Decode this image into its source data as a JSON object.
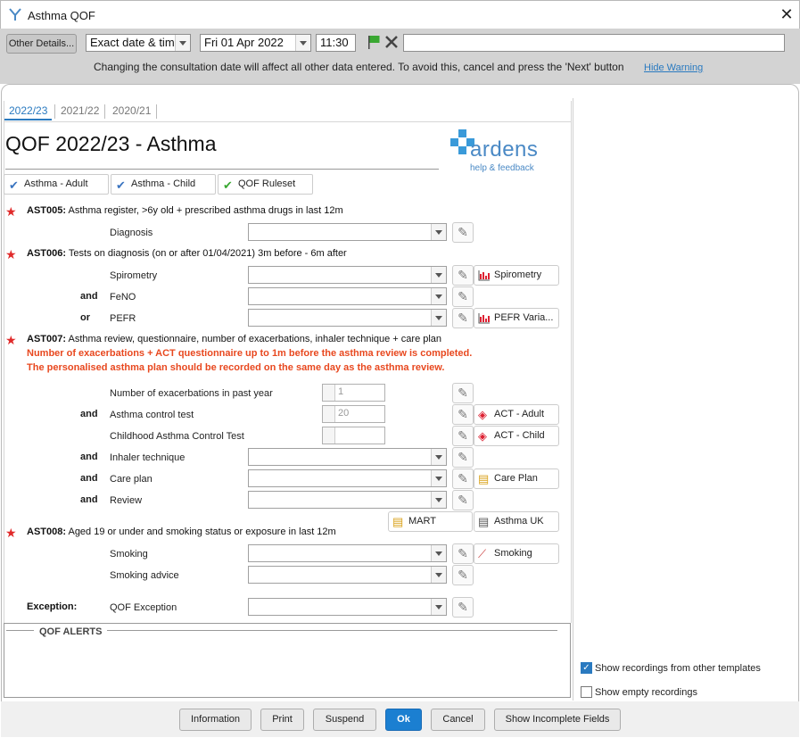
{
  "window": {
    "title": "Asthma QOF",
    "close_glyph": "✕"
  },
  "toolbar": {
    "other_details": "Other Details...",
    "date_mode": "Exact date & time",
    "date": "Fri 01 Apr 2022",
    "time": "11:30",
    "warning": "Changing the consultation date will affect all other data entered. To avoid this, cancel and press the 'Next' button",
    "hide_warning": "Hide Warning",
    "flag_color": "#3aa832"
  },
  "tabs": [
    "2022/23",
    "2021/22",
    "2020/21"
  ],
  "page_title": "QOF 2022/23 - Asthma",
  "logo": {
    "name": "ardens",
    "tagline": "help & feedback"
  },
  "chips": [
    {
      "label": "Asthma - Adult",
      "check_color": "#3a74c0"
    },
    {
      "label": "Asthma - Child",
      "check_color": "#3a74c0"
    },
    {
      "label": "QOF Ruleset",
      "check_color": "#3aa832"
    }
  ],
  "rules": {
    "ast005": {
      "code": "AST005:",
      "text": " Asthma register, >6y old + prescribed asthma drugs in last 12m"
    },
    "ast006": {
      "code": "AST006:",
      "text": " Tests on diagnosis (on or after 01/04/2021) 3m before - 6m after"
    },
    "ast007": {
      "code": "AST007:",
      "text": " Asthma review, questionnaire, number of exacerbations, inhaler technique + care plan",
      "note1": "Number of exacerbations + ACT questionnaire up to 1m before the asthma review is completed.",
      "note2": "The personalised asthma plan should be recorded on the same day as the asthma review."
    },
    "ast008": {
      "code": "AST008:",
      "text": " Aged 19 or under and smoking status or exposure in last 12m"
    }
  },
  "fields": {
    "diagnosis": "Diagnosis",
    "spirometry": "Spirometry",
    "feno": "FeNO",
    "pefr": "PEFR",
    "exacerbations": "Number of exacerbations in past year",
    "exacerbations_value": "1",
    "act": "Asthma control test",
    "act_value": "20",
    "cact": "Childhood Asthma Control Test",
    "inhaler": "Inhaler technique",
    "care_plan": "Care plan",
    "review": "Review",
    "smoking": "Smoking",
    "smoking_advice": "Smoking advice",
    "exception_heading": "Exception:",
    "qof_exception": "QOF Exception"
  },
  "conj": {
    "and": "and",
    "or": "or"
  },
  "action_buttons": {
    "spirometry": "Spirometry",
    "pefr": "PEFR Varia...",
    "act_adult": "ACT - Adult",
    "act_child": "ACT - Child",
    "care_plan": "Care Plan",
    "mart": "MART",
    "asthma_uk": "Asthma UK",
    "smoking": "Smoking"
  },
  "alerts": {
    "label": "QOF ALERTS"
  },
  "options": {
    "show_other": {
      "label": "Show recordings from other templates",
      "checked": true
    },
    "show_empty": {
      "label": "Show empty recordings",
      "checked": false
    }
  },
  "footer": {
    "information": "Information",
    "print": "Print",
    "suspend": "Suspend",
    "ok": "Ok",
    "cancel": "Cancel",
    "show_incomplete": "Show Incomplete Fields"
  },
  "colors": {
    "accent": "#2a7ac0",
    "required_star": "#e02a2a",
    "note_red": "#e8481f",
    "ok_button": "#1b7fd1"
  }
}
